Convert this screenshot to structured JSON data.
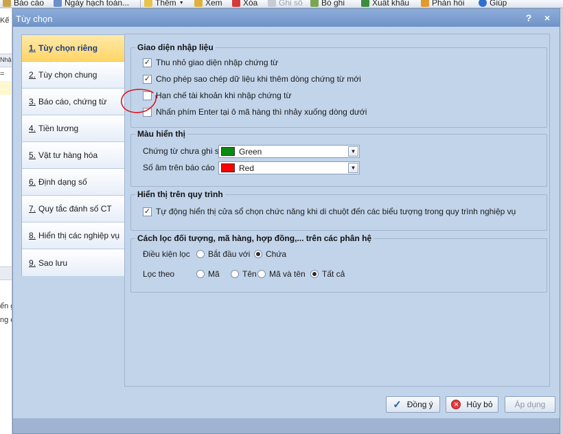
{
  "toolbar": {
    "items": [
      {
        "label": "Báo cáo",
        "icon": "report-icon",
        "enabled": true
      },
      {
        "label": "Ngày hạch toán...",
        "icon": "calendar-icon",
        "enabled": true
      },
      {
        "label": "Thêm",
        "icon": "add-icon",
        "enabled": true
      },
      {
        "label": "Xem",
        "icon": "view-icon",
        "enabled": true
      },
      {
        "label": "Xóa",
        "icon": "delete-icon",
        "enabled": true
      },
      {
        "label": "Ghi sổ",
        "icon": "post-icon",
        "enabled": false
      },
      {
        "label": "Bỏ ghi",
        "icon": "unpost-icon",
        "enabled": true
      },
      {
        "label": "Xuất khẩu",
        "icon": "export-icon",
        "enabled": true
      },
      {
        "label": "Phản hồi",
        "icon": "feedback-icon",
        "enabled": true
      },
      {
        "label": "Giúp",
        "icon": "help-icon",
        "enabled": true
      }
    ],
    "add_dropdown": "▼"
  },
  "background": {
    "fragments": [
      "Kế",
      "Nhập",
      "=",
      "ển g",
      "ng d"
    ]
  },
  "dialog": {
    "title": "Tùy chọn",
    "help_button": "?",
    "close_button": "×"
  },
  "sidebar": {
    "items": [
      {
        "num": "1.",
        "label": "Tùy chọn riêng",
        "active": true
      },
      {
        "num": "2.",
        "label": "Tùy chọn chung",
        "active": false
      },
      {
        "num": "3.",
        "label": "Báo cáo, chứng từ",
        "active": false
      },
      {
        "num": "4.",
        "label": "Tiền lương",
        "active": false
      },
      {
        "num": "5.",
        "label": "Vật tư hàng hóa",
        "active": false
      },
      {
        "num": "6.",
        "label": "Định dạng số",
        "active": false
      },
      {
        "num": "7.",
        "label": "Quy tắc đánh số CT",
        "active": false
      },
      {
        "num": "8.",
        "label": "Hiển thị các nghiệp vụ",
        "active": false
      },
      {
        "num": "9.",
        "label": "Sao lưu",
        "active": false
      }
    ]
  },
  "input_ui": {
    "legend": "Giao diện nhập liệu",
    "options": [
      {
        "label": "Thu nhỏ giao diện nhập chứng từ",
        "checked": true,
        "mark": "✓"
      },
      {
        "label": "Cho phép sao chép dữ liệu khi thêm dòng chứng từ mới",
        "checked": true,
        "mark": "✓"
      },
      {
        "label": "Hạn chế tài khoản khi nhập chứng từ",
        "checked": false,
        "mark": ""
      },
      {
        "label": "Nhấn phím Enter tại ô mã hàng thì nhảy xuống dòng dưới",
        "checked": false,
        "mark": ""
      }
    ]
  },
  "display_colors": {
    "legend": "Màu hiển thị",
    "rows": [
      {
        "label": "Chứng từ chưa ghi sổ",
        "value": "Green",
        "color": "#0a8a12"
      },
      {
        "label": "Số âm trên báo cáo",
        "value": "Red",
        "color": "#ff0000"
      }
    ],
    "arrow": "▼"
  },
  "process_display": {
    "legend": "Hiển thị trên quy trình",
    "option": {
      "label": "Tự động hiển thị cửa sổ chọn chức năng khi di chuột đến các biểu tượng trong quy trình nghiệp vụ",
      "checked": true,
      "mark": "✓"
    }
  },
  "filter": {
    "legend": "Cách lọc đối tượng, mã hàng, hợp đồng,... trên các phân hệ",
    "condition_label": "Điều kiện lọc",
    "condition_options": [
      {
        "label": "Bắt đầu với",
        "selected": false
      },
      {
        "label": "Chứa",
        "selected": true
      }
    ],
    "by_label": "Lọc theo",
    "by_options": [
      {
        "label": "Mã",
        "selected": false
      },
      {
        "label": "Tên",
        "selected": false
      },
      {
        "label": "Mã và tên",
        "selected": false
      },
      {
        "label": "Tất cả",
        "selected": true
      }
    ]
  },
  "buttons": {
    "ok": "Đồng ý",
    "cancel": "Hủy bỏ",
    "apply": "Áp dụng",
    "ok_icon": "✓",
    "cancel_icon": "✕"
  },
  "colors": {
    "title_bar": "#7a9ccd",
    "active_tab": "#ffd566",
    "annotation": "#e0141e"
  }
}
